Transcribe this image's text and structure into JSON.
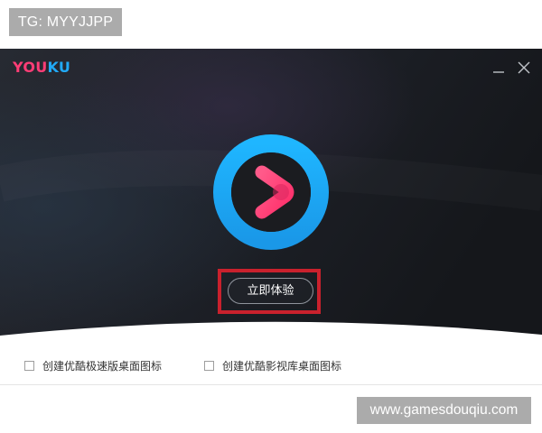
{
  "watermarks": {
    "top": "TG: MYYJJPP",
    "bottom": "www.gamesdouqiu.com"
  },
  "app": {
    "logo_part_a": "YOU",
    "logo_part_b": "KU"
  },
  "window_controls": {
    "minimize_icon": "minimize-icon",
    "close_icon": "close-icon"
  },
  "main": {
    "play_icon": "youku-play-logo-icon",
    "try_button_label": "立即体验"
  },
  "options": [
    {
      "label": "创建优酷极速版桌面图标",
      "checked": false
    },
    {
      "label": "创建优酷影视库桌面图标",
      "checked": false
    }
  ],
  "colors": {
    "accent_pink": "#ff3d76",
    "accent_blue": "#21a9f5",
    "highlight_red": "#c9212d",
    "hero_dark": "#1e2128"
  }
}
